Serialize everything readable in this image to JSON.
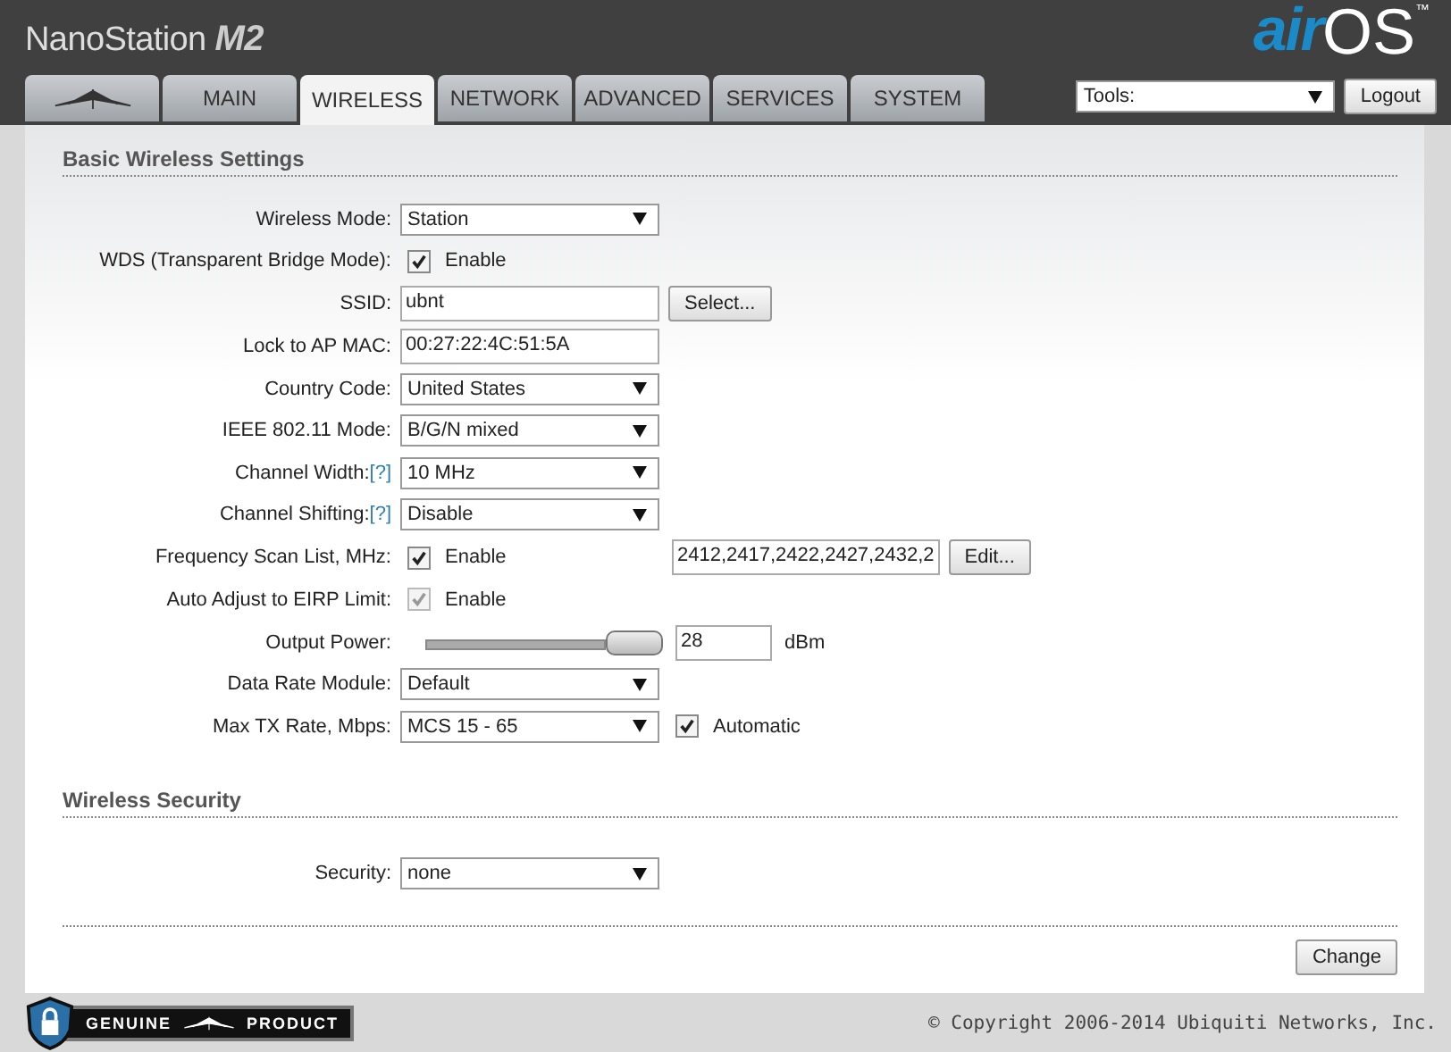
{
  "header": {
    "product": "NanoStation",
    "model": "M2",
    "brand_air": "air",
    "brand_os": "OS",
    "tm": "™"
  },
  "tabs": [
    {
      "kind": "logo",
      "selected": false
    },
    {
      "label": "MAIN",
      "selected": false
    },
    {
      "label": "WIRELESS",
      "selected": true
    },
    {
      "label": "NETWORK",
      "selected": false
    },
    {
      "label": "ADVANCED",
      "selected": false
    },
    {
      "label": "SERVICES",
      "selected": false
    },
    {
      "label": "SYSTEM",
      "selected": false
    }
  ],
  "tools": {
    "value": "Tools:",
    "logout": "Logout"
  },
  "sections": [
    {
      "title": "Basic Wireless Settings",
      "rows": [
        {
          "label": "Wireless Mode:",
          "controls": [
            {
              "kind": "select",
              "value": "Station"
            }
          ]
        },
        {
          "label": "WDS (Transparent Bridge Mode):",
          "controls": [
            {
              "kind": "checkbox",
              "label": "Enable",
              "checked": true,
              "disabled": false
            }
          ]
        },
        {
          "label": "SSID:",
          "controls": [
            {
              "kind": "text",
              "value": "ubnt"
            },
            {
              "kind": "button",
              "label": "Select..."
            }
          ]
        },
        {
          "label": "Lock to AP MAC:",
          "controls": [
            {
              "kind": "text",
              "value": "00:27:22:4C:51:5A"
            }
          ]
        },
        {
          "label": "Country Code:",
          "controls": [
            {
              "kind": "select",
              "value": "United States"
            }
          ]
        },
        {
          "label": "IEEE 802.11 Mode:",
          "controls": [
            {
              "kind": "select",
              "value": "B/G/N mixed"
            }
          ]
        },
        {
          "label": "Channel Width:",
          "help": "[?]",
          "controls": [
            {
              "kind": "select",
              "value": "10 MHz"
            }
          ]
        },
        {
          "label": "Channel Shifting:",
          "help": "[?]",
          "controls": [
            {
              "kind": "select",
              "value": "Disable"
            }
          ]
        },
        {
          "label": "Frequency Scan List, MHz:",
          "controls": [
            {
              "kind": "checkbox",
              "label": "Enable",
              "checked": true,
              "disabled": false
            },
            {
              "kind": "text",
              "value": "2412,2417,2422,2427,2432,2"
            },
            {
              "kind": "button",
              "label": "Edit..."
            }
          ]
        },
        {
          "label": "Auto Adjust to EIRP Limit:",
          "controls": [
            {
              "kind": "checkbox",
              "label": "Enable",
              "checked": true,
              "disabled": true
            }
          ]
        },
        {
          "label": "Output Power:",
          "controls": [
            {
              "kind": "slider",
              "level": 1
            },
            {
              "kind": "short",
              "value": "28"
            },
            {
              "kind": "unit",
              "text": "dBm"
            }
          ]
        },
        {
          "label": "Data Rate Module:",
          "controls": [
            {
              "kind": "select",
              "value": "Default"
            }
          ]
        },
        {
          "label": "Max TX Rate, Mbps:",
          "controls": [
            {
              "kind": "select",
              "value": "MCS 15 - 65"
            },
            {
              "kind": "checkbox",
              "label": "Automatic",
              "checked": true,
              "disabled": false
            }
          ]
        }
      ]
    },
    {
      "title": "Wireless Security",
      "rows": [
        {
          "label": "Security:",
          "controls": [
            {
              "kind": "select",
              "value": "none"
            }
          ]
        }
      ]
    }
  ],
  "change_button": "Change",
  "footer": {
    "badge_left": "GENUINE",
    "badge_right": "PRODUCT",
    "copyright": "© Copyright 2006-2014 Ubiquiti Networks, Inc."
  }
}
